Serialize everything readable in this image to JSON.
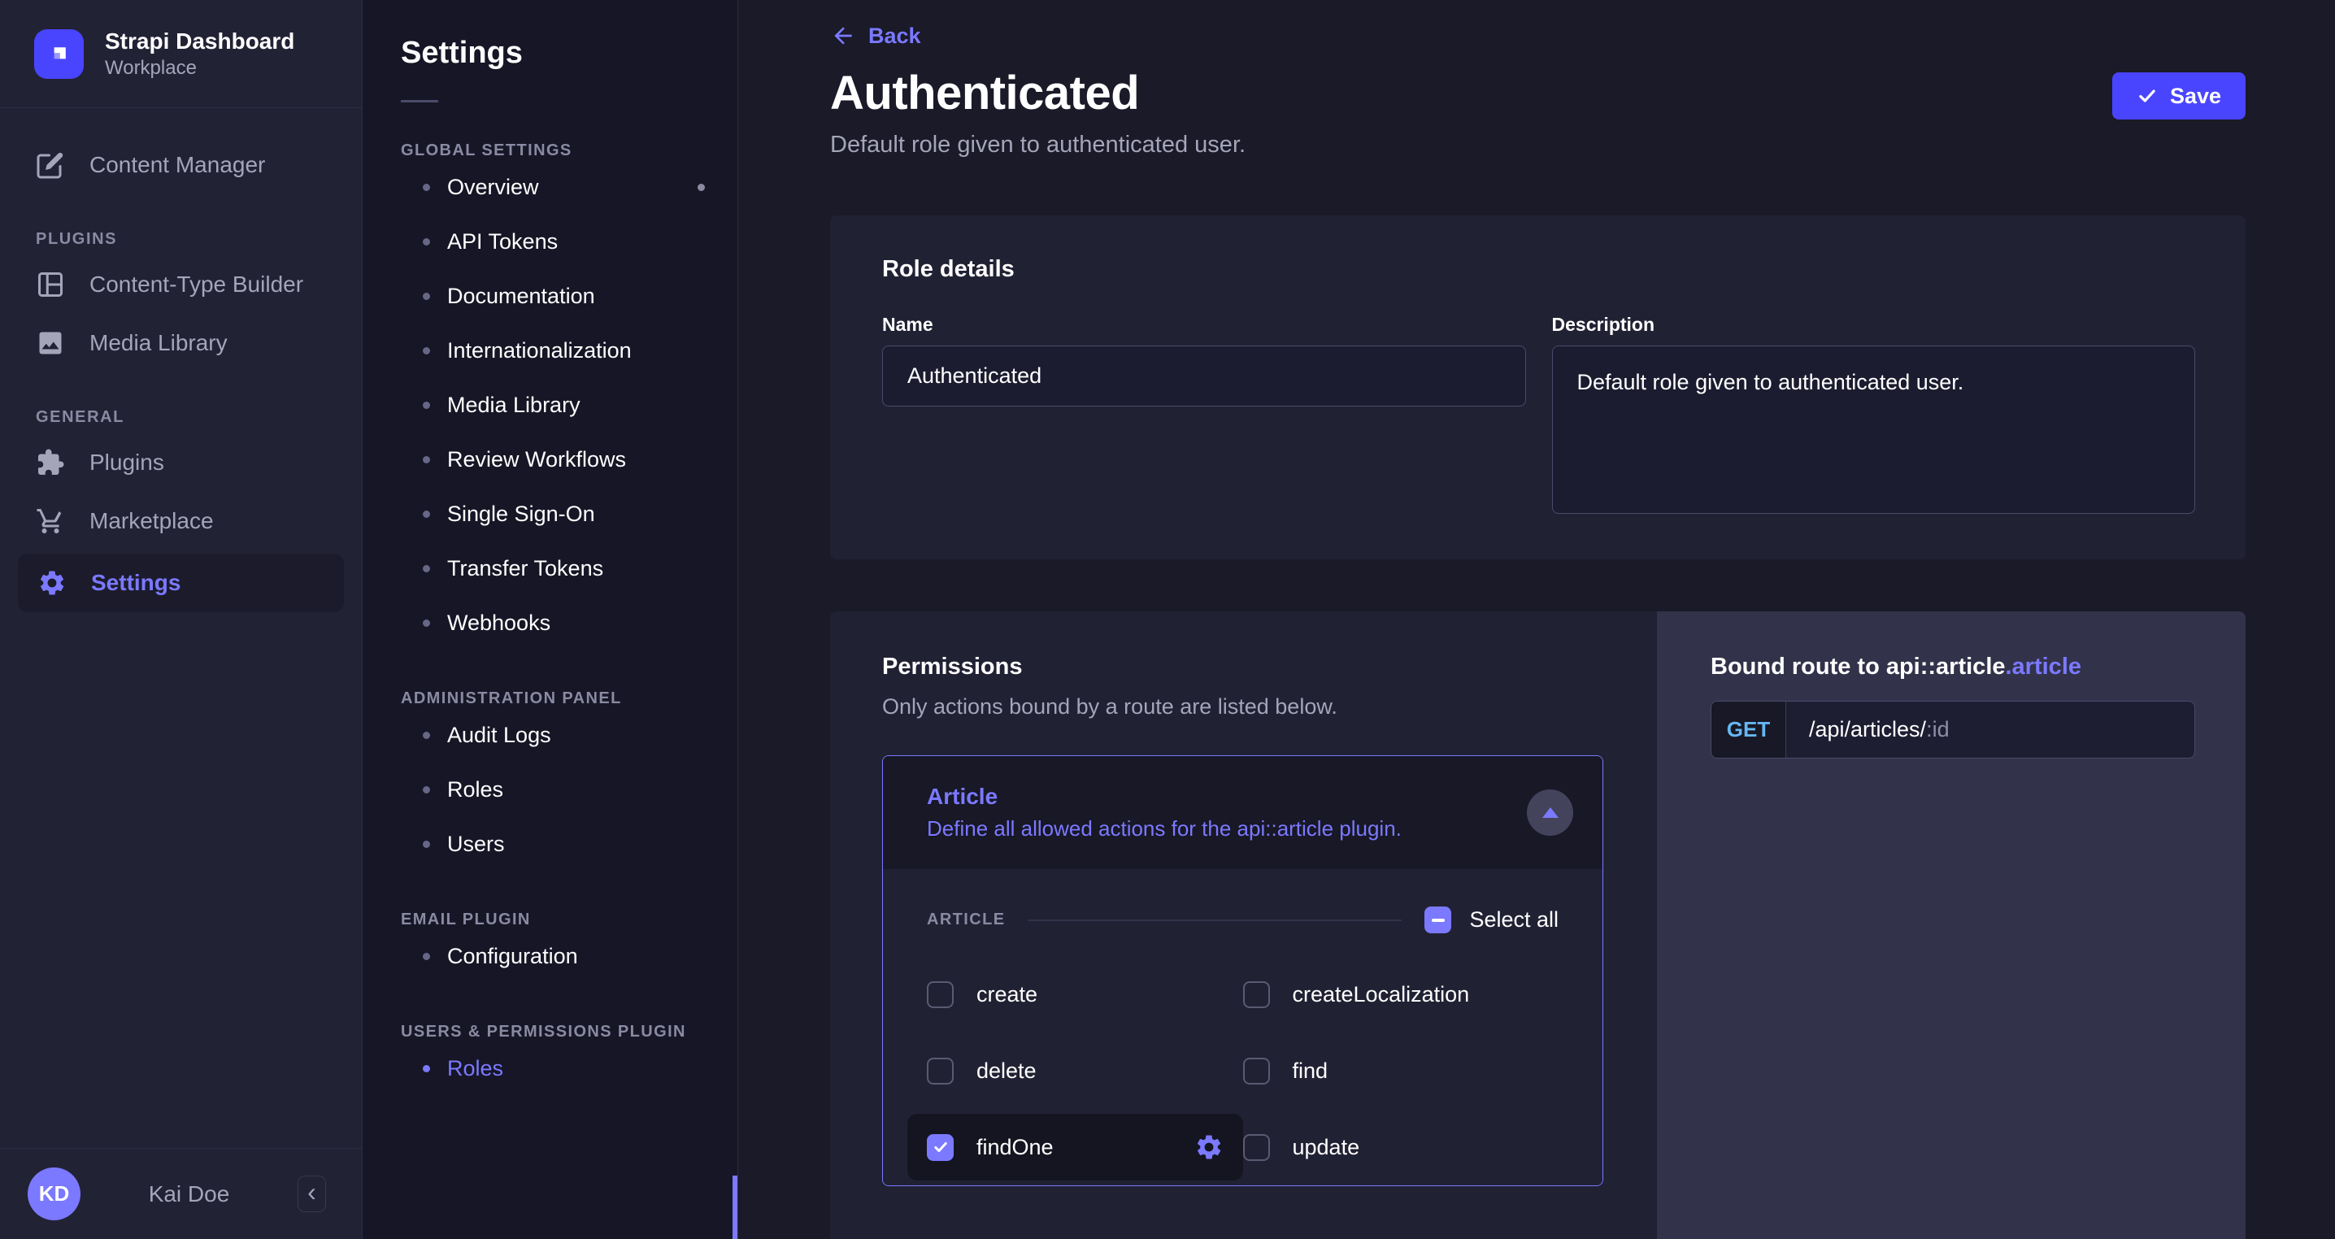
{
  "colors": {
    "primary": "#4945ff",
    "accent": "#7b79ff",
    "method_get": "#66b7f1",
    "card_bg": "#212134",
    "panel_bg": "#32324a"
  },
  "sidebar": {
    "brand": {
      "title": "Strapi Dashboard",
      "subtitle": "Workplace"
    },
    "items": [
      {
        "label": "Content Manager"
      }
    ],
    "sections": [
      {
        "label": "PLUGINS",
        "items": [
          {
            "label": "Content-Type Builder"
          },
          {
            "label": "Media Library"
          }
        ]
      },
      {
        "label": "GENERAL",
        "items": [
          {
            "label": "Plugins"
          },
          {
            "label": "Marketplace"
          },
          {
            "label": "Settings",
            "active": true
          }
        ]
      }
    ],
    "user": {
      "initials": "KD",
      "name": "Kai Doe",
      "collapse_glyph": "‹"
    }
  },
  "subnav": {
    "title": "Settings",
    "sections": [
      {
        "label": "GLOBAL SETTINGS",
        "items": [
          {
            "label": "Overview",
            "dot": true
          },
          {
            "label": "API Tokens"
          },
          {
            "label": "Documentation"
          },
          {
            "label": "Internationalization"
          },
          {
            "label": "Media Library"
          },
          {
            "label": "Review Workflows"
          },
          {
            "label": "Single Sign-On"
          },
          {
            "label": "Transfer Tokens"
          },
          {
            "label": "Webhooks"
          }
        ]
      },
      {
        "label": "ADMINISTRATION PANEL",
        "items": [
          {
            "label": "Audit Logs"
          },
          {
            "label": "Roles"
          },
          {
            "label": "Users"
          }
        ]
      },
      {
        "label": "EMAIL PLUGIN",
        "items": [
          {
            "label": "Configuration"
          }
        ]
      },
      {
        "label": "USERS & PERMISSIONS PLUGIN",
        "items": [
          {
            "label": "Roles",
            "active": true
          }
        ]
      }
    ]
  },
  "header": {
    "back": "Back",
    "title": "Authenticated",
    "subtitle": "Default role given to authenticated user.",
    "save": "Save"
  },
  "role_details": {
    "title": "Role details",
    "name_label": "Name",
    "name_value": "Authenticated",
    "description_label": "Description",
    "description_value": "Default role given to authenticated user."
  },
  "permissions": {
    "title": "Permissions",
    "subtitle": "Only actions bound by a route are listed below.",
    "accordion": {
      "title": "Article",
      "description": "Define all allowed actions for the api::article plugin."
    },
    "group_label": "ARTICLE",
    "select_all": "Select all",
    "actions": [
      {
        "label": "create",
        "checked": false
      },
      {
        "label": "createLocalization",
        "checked": false
      },
      {
        "label": "delete",
        "checked": false
      },
      {
        "label": "find",
        "checked": false
      },
      {
        "label": "findOne",
        "checked": true,
        "selected": true
      },
      {
        "label": "update",
        "checked": false
      }
    ]
  },
  "bound_route": {
    "title_main": "Bound route to api::article",
    "title_accent": ".article",
    "method": "GET",
    "path": "/api/articles/",
    "param": ":id"
  }
}
